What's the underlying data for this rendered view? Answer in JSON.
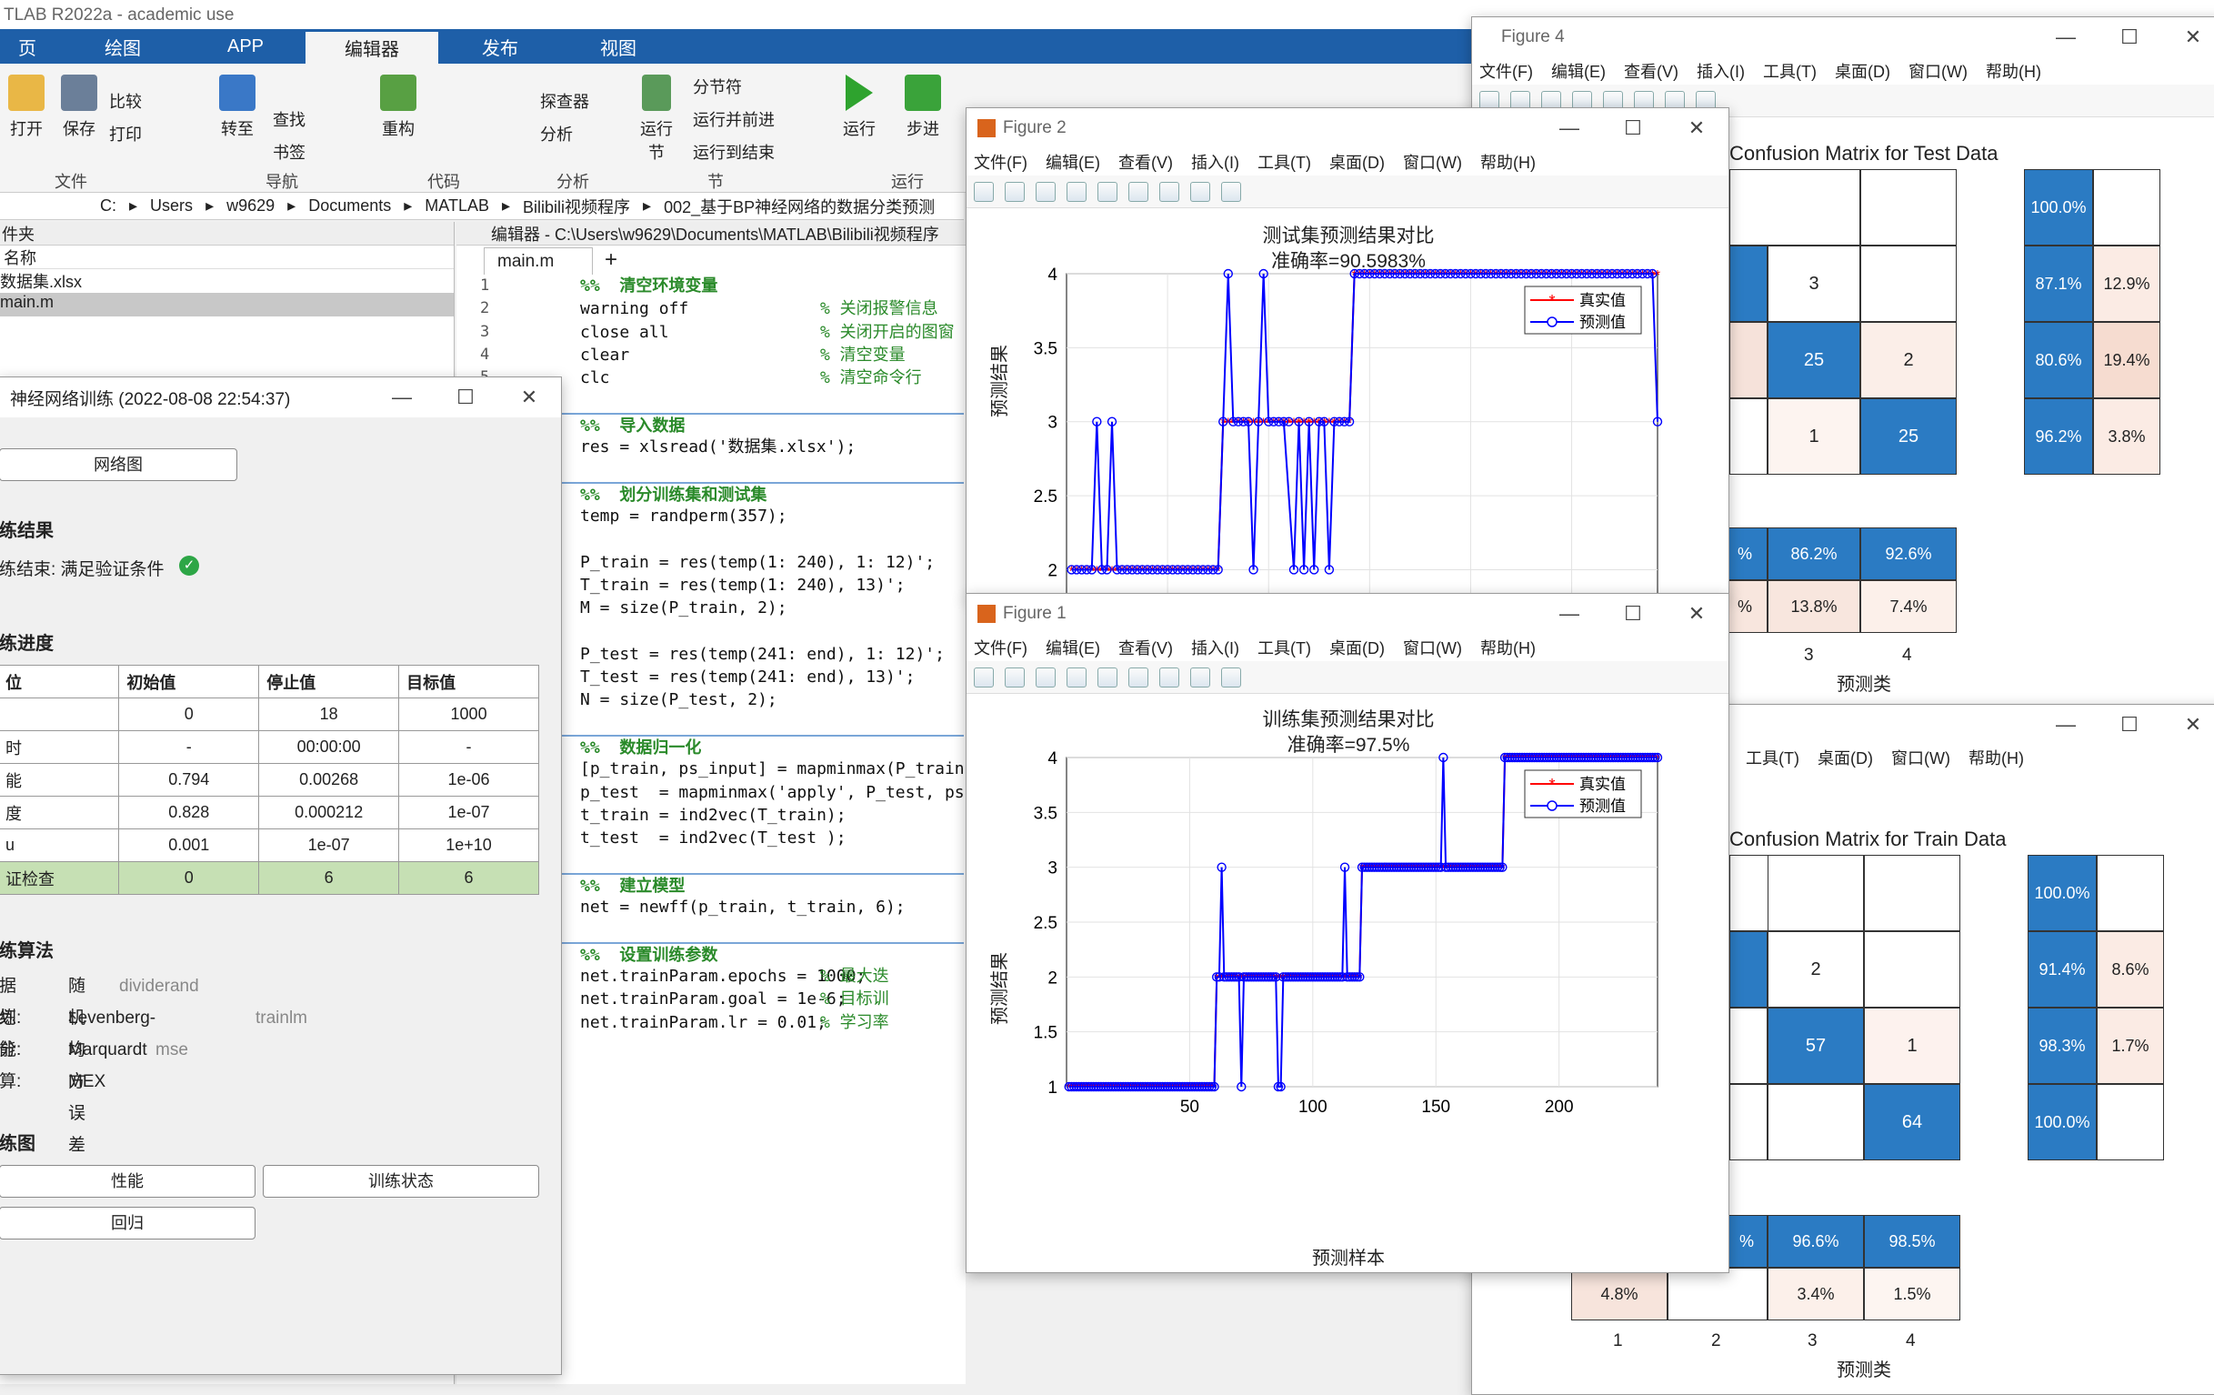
{
  "app": {
    "title": "TLAB R2022a - academic use",
    "tabs": [
      "页",
      "绘图",
      "APP",
      "编辑器",
      "发布",
      "视图"
    ],
    "ribbon": {
      "open": "打开",
      "save": "保存",
      "compare": "比较",
      "print": "打印",
      "goto": "转至",
      "find": "查找",
      "bookmark": "书签",
      "refactor": "重构",
      "explorer": "探查器",
      "analyze": "分析",
      "run_section": "运行\n节",
      "section_break": "分节符",
      "run_advance": "运行并前进",
      "run_to_end": "运行到结束",
      "run": "运行",
      "step": "步进",
      "groups": [
        "文件",
        "导航",
        "代码",
        "分析",
        "节",
        "运行"
      ]
    },
    "path": [
      "C:",
      "Users",
      "w9629",
      "Documents",
      "MATLAB",
      "Bilibili视频程序",
      "002_基于BP神经网络的数据分类预测"
    ]
  },
  "files": {
    "header": "件夹",
    "name_col": "名称",
    "items": [
      "数据集.xlsx",
      "main.m"
    ]
  },
  "editor": {
    "title": "编辑器 - C:\\Users\\w9629\\Documents\\MATLAB\\Bilibili视频程序",
    "tab": "main.m",
    "lines": [
      {
        "n": "1",
        "code": "%%  清空环境变量",
        "c": "sec"
      },
      {
        "n": "2",
        "code": "warning off",
        "cm": "% 关闭报警信息"
      },
      {
        "n": "3",
        "code": "close all",
        "cm": "% 关闭开启的图窗"
      },
      {
        "n": "4",
        "code": "clear",
        "cm": "% 清空变量"
      },
      {
        "n": "5",
        "code": "clc",
        "cm": "% 清空命令行"
      },
      {
        "n": "",
        "code": ""
      },
      {
        "n": "",
        "code": "%%  导入数据",
        "c": "sec"
      },
      {
        "n": "",
        "code": "res = xlsread('数据集.xlsx');"
      },
      {
        "n": "",
        "code": ""
      },
      {
        "n": "",
        "code": "%%  划分训练集和测试集",
        "c": "sec"
      },
      {
        "n": "",
        "code": "temp = randperm(357);"
      },
      {
        "n": "",
        "code": ""
      },
      {
        "n": "",
        "code": "P_train = res(temp(1: 240), 1: 12)';"
      },
      {
        "n": "",
        "code": "T_train = res(temp(1: 240), 13)';"
      },
      {
        "n": "",
        "code": "M = size(P_train, 2);"
      },
      {
        "n": "",
        "code": ""
      },
      {
        "n": "",
        "code": "P_test = res(temp(241: end), 1: 12)';"
      },
      {
        "n": "",
        "code": "T_test = res(temp(241: end), 13)';"
      },
      {
        "n": "",
        "code": "N = size(P_test, 2);"
      },
      {
        "n": "",
        "code": ""
      },
      {
        "n": "",
        "code": "%%  数据归一化",
        "c": "sec"
      },
      {
        "n": "",
        "code": "[p_train, ps_input] = mapminmax(P_train"
      },
      {
        "n": "",
        "code": "p_test  = mapminmax('apply', P_test, ps"
      },
      {
        "n": "",
        "code": "t_train = ind2vec(T_train);"
      },
      {
        "n": "",
        "code": "t_test  = ind2vec(T_test );"
      },
      {
        "n": "",
        "code": ""
      },
      {
        "n": "",
        "code": "%%  建立模型",
        "c": "sec"
      },
      {
        "n": "",
        "code": "net = newff(p_train, t_train, 6);"
      },
      {
        "n": "",
        "code": ""
      },
      {
        "n": "",
        "code": "%%  设置训练参数",
        "c": "sec"
      },
      {
        "n": "",
        "code": "net.trainParam.epochs = 1000;",
        "cm": "% 最大迭"
      },
      {
        "n": "",
        "code": "net.trainParam.goal = 1e-6;",
        "cm": "% 目标训"
      },
      {
        "n": "",
        "code": "net.trainParam.lr = 0.01;",
        "cm": "% 学习率"
      }
    ]
  },
  "train": {
    "title": "神经网络训练 (2022-08-08 22:54:37)",
    "net_btn": "网络图",
    "results_h": "练结果",
    "result_text": "练结束: 满足验证条件",
    "progress_h": "练进度",
    "table": {
      "head": [
        "位",
        "初始值",
        "停止值",
        "目标值"
      ],
      "rows": [
        [
          "",
          "0",
          "18",
          "1000"
        ],
        [
          "时",
          "-",
          "00:00:00",
          "-"
        ],
        [
          "能",
          "0.794",
          "0.00268",
          "1e-06"
        ],
        [
          "度",
          "0.828",
          "0.000212",
          "1e-07"
        ],
        [
          "u",
          "0.001",
          "1e-07",
          "1e+10"
        ],
        [
          "证检查",
          "0",
          "6",
          "6"
        ]
      ]
    },
    "algo_h": "练算法",
    "algo": [
      [
        "据划分:",
        "随机",
        "dividerand"
      ],
      [
        "练:",
        "Levenberg-Marquardt",
        "trainlm"
      ],
      [
        "能:",
        "均方误差",
        "mse"
      ],
      [
        "算:",
        "MEX",
        ""
      ]
    ],
    "plots_h": "练图",
    "plot_btns": [
      "性能",
      "训练状态",
      "回归"
    ]
  },
  "menus": [
    "文件(F)",
    "编辑(E)",
    "查看(V)",
    "插入(I)",
    "工具(T)",
    "桌面(D)",
    "窗口(W)",
    "帮助(H)"
  ],
  "fig2": {
    "title": "Figure 2",
    "plot_title": "测试集预测结果对比",
    "acc": "准确率=90.5983%",
    "ylabel": "预测结果",
    "legend": [
      "真实值",
      "预测值"
    ],
    "yticks": [
      "4",
      "3.5",
      "3",
      "2.5",
      "2"
    ]
  },
  "fig1": {
    "title": "Figure 1",
    "plot_title": "训练集预测结果对比",
    "acc": "准确率=97.5%",
    "ylabel": "预测结果",
    "xlabel": "预测样本",
    "legend": [
      "真实值",
      "预测值"
    ],
    "yticks": [
      "4",
      "3.5",
      "3",
      "2.5",
      "2",
      "1.5",
      "1"
    ],
    "xticks": [
      "50",
      "100",
      "150",
      "200"
    ]
  },
  "fig4": {
    "title": "Figure 4",
    "cm_title": "Confusion Matrix for Test Data",
    "cells": [
      "3",
      "25",
      "2",
      "1",
      "25"
    ],
    "right": [
      [
        "100.0%",
        ""
      ],
      [
        "87.1%",
        "12.9%"
      ],
      [
        "80.6%",
        "19.4%"
      ],
      [
        "96.2%",
        "3.8%"
      ]
    ],
    "bottom": [
      [
        "%",
        "86.2%",
        "92.6%"
      ],
      [
        "%",
        "13.8%",
        "7.4%"
      ]
    ],
    "xt": [
      "3",
      "4"
    ],
    "xlabel": "预测类"
  },
  "fig3": {
    "menus": [
      "工具(T)",
      "桌面(D)",
      "窗口(W)",
      "帮助(H)"
    ],
    "cm_title": "Confusion Matrix for Train Data",
    "cells": [
      "2",
      "57",
      "1",
      "64"
    ],
    "right": [
      [
        "100.0%",
        ""
      ],
      [
        "91.4%",
        "8.6%"
      ],
      [
        "98.3%",
        "1.7%"
      ],
      [
        "100.0%",
        ""
      ]
    ],
    "bottom": [
      [
        "%",
        "96.6%",
        "98.5%"
      ],
      [
        "4.8%",
        "",
        "3.4%",
        "1.5%"
      ]
    ],
    "xt": [
      "1",
      "2",
      "3",
      "4"
    ],
    "xlabel": "预测类"
  },
  "chart_data": [
    {
      "type": "line",
      "title": "测试集预测结果对比",
      "subtitle": "准确率=90.5983%",
      "ylabel": "预测结果",
      "ylim": [
        1.8,
        4
      ],
      "xlim": [
        0,
        117
      ],
      "series": [
        {
          "name": "真实值",
          "color": "#ff0000",
          "x": [
            1,
            30,
            31,
            56,
            57,
            117
          ],
          "y": [
            2,
            2,
            3,
            3,
            4,
            4
          ]
        },
        {
          "name": "预测值",
          "color": "#0000ff",
          "x": [
            1,
            5,
            6,
            7,
            8,
            9,
            10,
            11,
            12,
            30,
            31,
            32,
            33,
            34,
            35,
            36,
            37,
            38,
            39,
            40,
            41,
            42,
            43,
            45,
            46,
            47,
            48,
            49,
            50,
            51,
            52,
            53,
            54,
            56,
            57,
            115,
            116,
            117
          ],
          "y": [
            2,
            2,
            3,
            2,
            2,
            3,
            2,
            2,
            2,
            2,
            3,
            4,
            3,
            3,
            3,
            3,
            2,
            3,
            4,
            3,
            3,
            3,
            3,
            2,
            3,
            2,
            3,
            2,
            3,
            3,
            2,
            3,
            3,
            3,
            4,
            4,
            4,
            3
          ]
        }
      ]
    },
    {
      "type": "line",
      "title": "训练集预测结果对比",
      "subtitle": "准确率=97.5%",
      "xlabel": "预测样本",
      "ylabel": "预测结果",
      "ylim": [
        1,
        4
      ],
      "xlim": [
        0,
        240
      ],
      "series": [
        {
          "name": "真实值",
          "color": "#ff0000",
          "x": [
            1,
            60,
            61,
            119,
            120,
            177,
            178,
            240
          ],
          "y": [
            1,
            1,
            2,
            2,
            3,
            3,
            4,
            4
          ]
        },
        {
          "name": "预测值",
          "color": "#0000ff",
          "x": [
            1,
            60,
            61,
            62,
            63,
            64,
            70,
            71,
            72,
            85,
            86,
            87,
            88,
            89,
            112,
            113,
            114,
            119,
            120,
            152,
            153,
            154,
            177,
            178,
            240
          ],
          "y": [
            1,
            1,
            2,
            2,
            3,
            2,
            2,
            1,
            2,
            2,
            1,
            1,
            2,
            2,
            2,
            3,
            2,
            2,
            3,
            3,
            4,
            3,
            3,
            4,
            4
          ]
        }
      ]
    }
  ]
}
